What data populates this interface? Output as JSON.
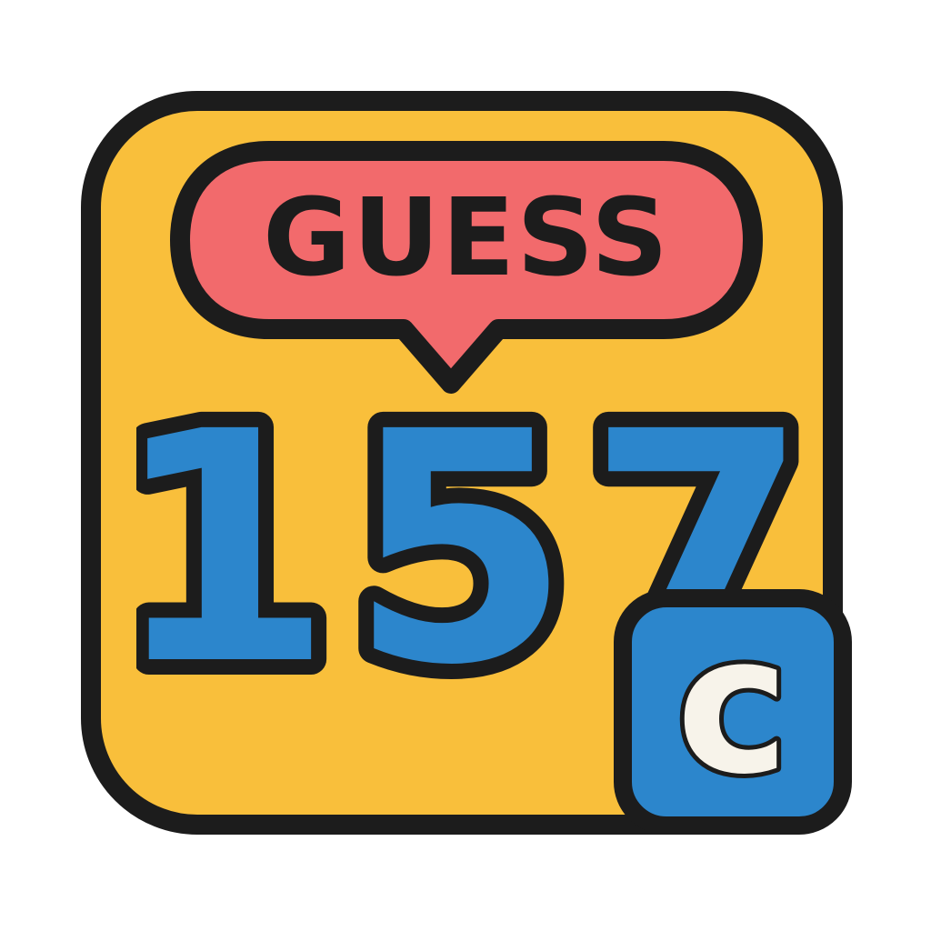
{
  "app_icon": {
    "bubble_text": "GUESS",
    "number_text": "157",
    "badge_letter": "c",
    "icons": {
      "speech_bubble": "speech-bubble-icon",
      "badge": "letter-c-badge-icon"
    },
    "colors": {
      "tile": "#f9bf3b",
      "outline": "#1c1c1c",
      "bubble": "#f26a6c",
      "number": "#2c86cc",
      "badge": "#2c86cc",
      "badge_letter": "#f7f3ea"
    }
  }
}
